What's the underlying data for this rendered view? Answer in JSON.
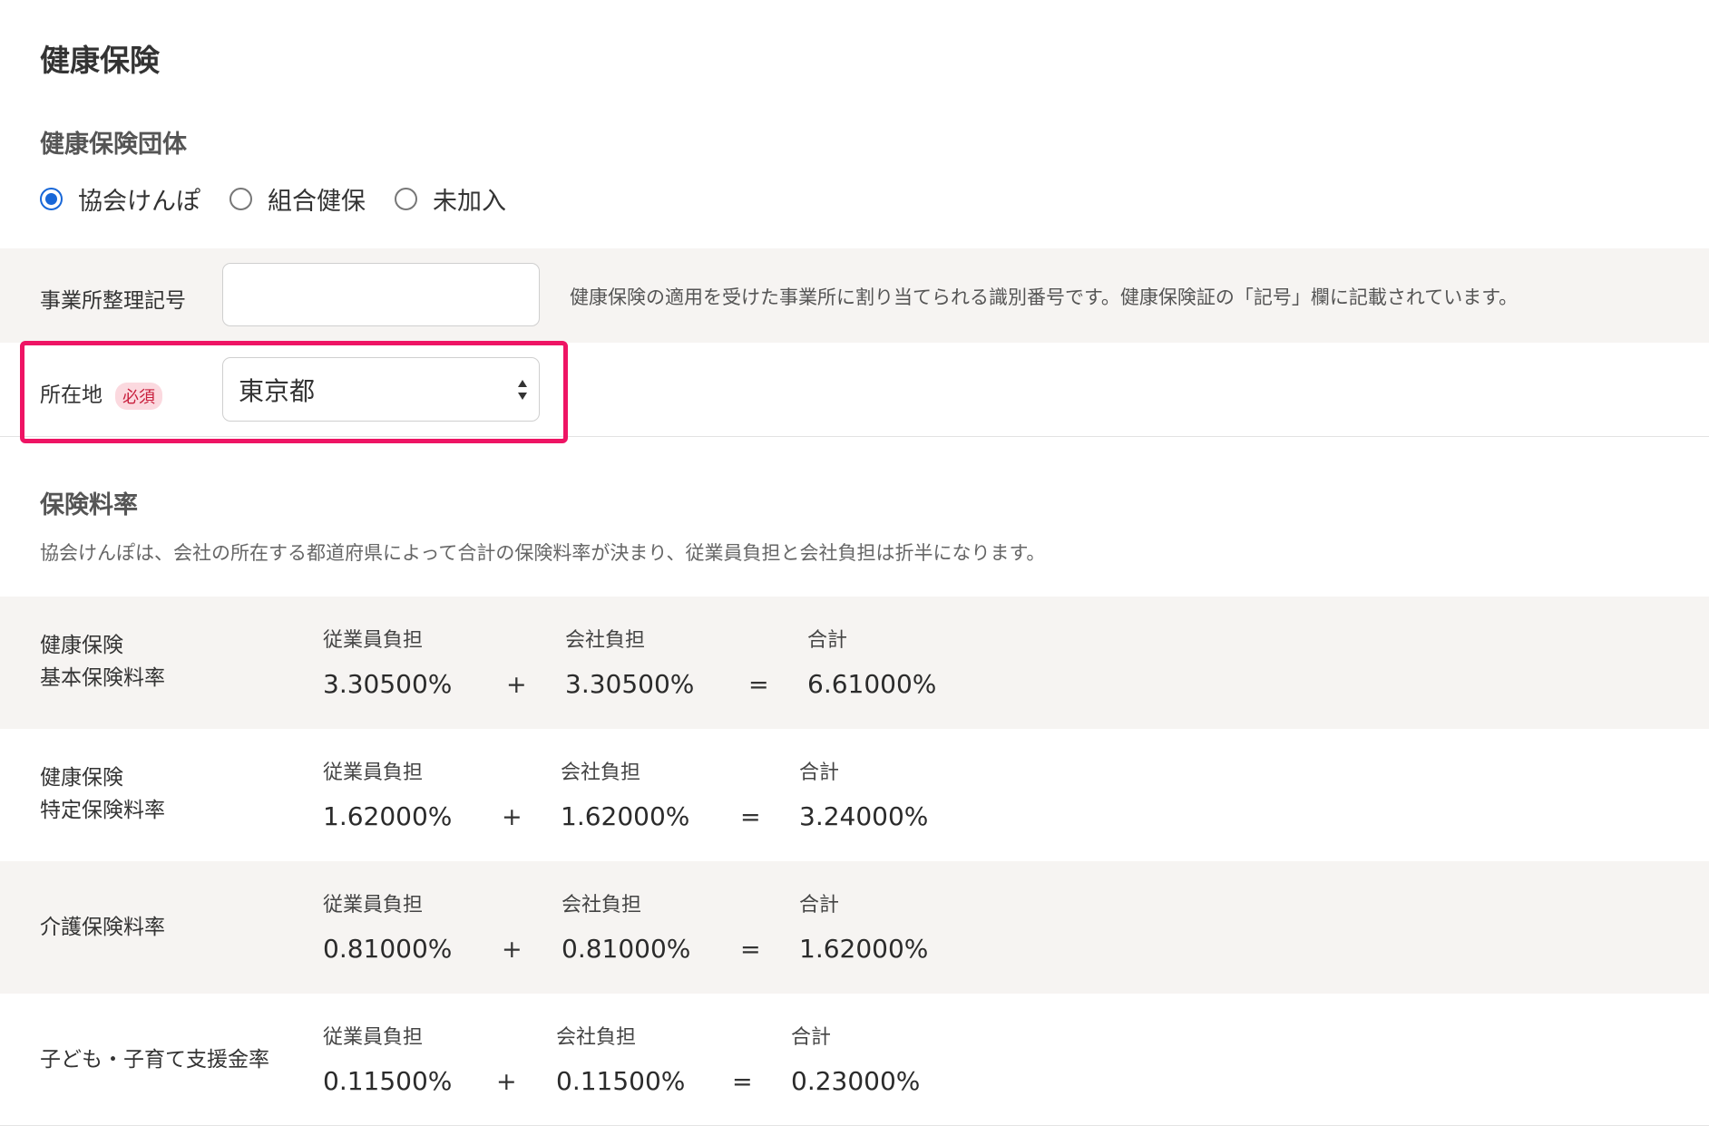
{
  "health_insurance": {
    "title": "健康保険",
    "org_title": "健康保険団体",
    "radio_options": [
      {
        "label": "協会けんぽ",
        "checked": true
      },
      {
        "label": "組合健保",
        "checked": false
      },
      {
        "label": "未加入",
        "checked": false
      }
    ],
    "office_number": {
      "label": "事業所整理記号",
      "value": "",
      "help": "健康保険の適用を受けた事業所に割り当てられる識別番号です。健康保険証の「記号」欄に記載されています。"
    },
    "location": {
      "label": "所在地",
      "required_badge": "必須",
      "selected": "東京都"
    }
  },
  "insurance_rates": {
    "title": "保険料率",
    "description": "協会けんぽは、会社の所在する都道府県によって合計の保険料率が決まり、従業員負担と会社負担は折半になります。",
    "headers": {
      "employee": "従業員負担",
      "company": "会社負担",
      "total": "合計"
    },
    "operators": {
      "plus": "+",
      "equals": "="
    },
    "rows": [
      {
        "name_line1": "健康保険",
        "name_line2": "基本保険料率",
        "employee": "3.30500%",
        "company": "3.30500%",
        "total": "6.61000%"
      },
      {
        "name_line1": "健康保険",
        "name_line2": "特定保険料率",
        "employee": "1.62000%",
        "company": "1.62000%",
        "total": "3.24000%"
      },
      {
        "name_line1": "介護保険料率",
        "name_line2": "",
        "employee": "0.81000%",
        "company": "0.81000%",
        "total": "1.62000%"
      },
      {
        "name_line1": "子ども・子育て支援金率",
        "name_line2": "",
        "employee": "0.11500%",
        "company": "0.11500%",
        "total": "0.23000%"
      }
    ]
  },
  "colors": {
    "accent": "#1867d8",
    "highlight": "#ee1464",
    "required_badge_bg": "#fbd9df",
    "required_badge_text": "#c81e3c",
    "shaded_row": "#f6f4f2"
  }
}
